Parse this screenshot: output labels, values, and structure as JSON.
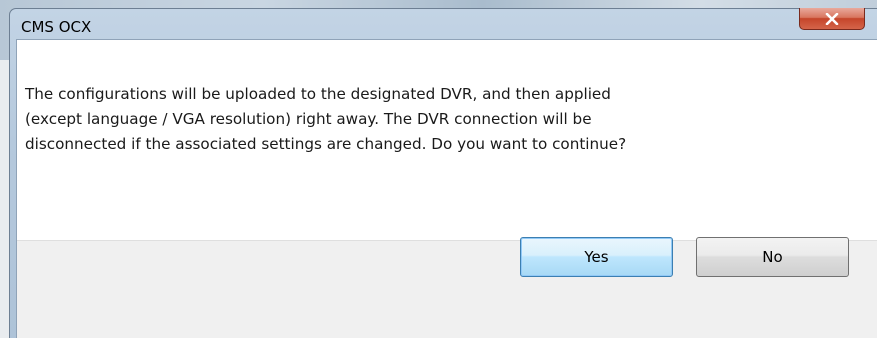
{
  "dialog": {
    "title": "CMS OCX",
    "message": "The configurations will be uploaded to the designated DVR, and then applied\n(except language / VGA resolution) right away.  The DVR connection will be\ndisconnected if the associated settings are changed.  Do you want to continue?",
    "close_icon": "close-icon",
    "buttons": {
      "yes_label": "Yes",
      "no_label": "No"
    }
  },
  "colors": {
    "close_button": "#c5452a",
    "title_bar": "#b5c9dd",
    "default_button_border": "#3c7fb1"
  }
}
